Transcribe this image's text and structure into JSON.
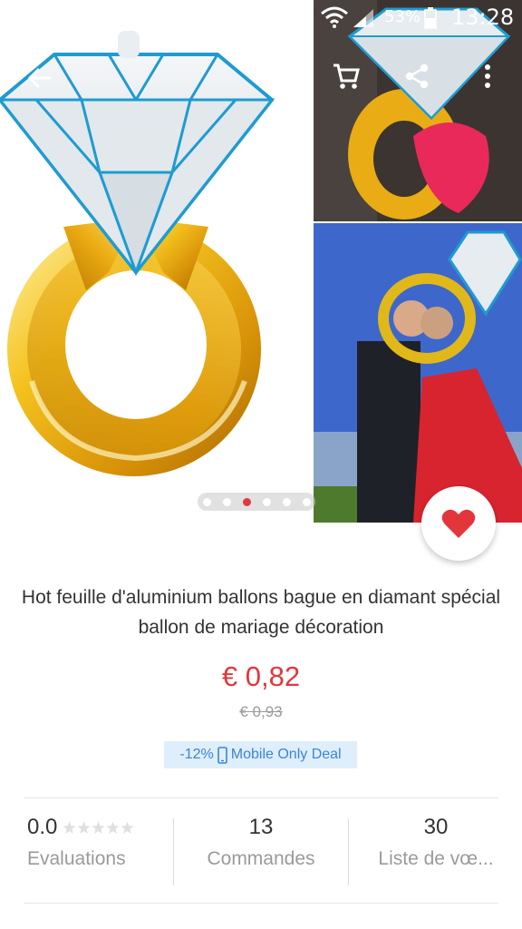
{
  "status_bar": {
    "battery_percent": "53%",
    "time": "13:28",
    "icons": [
      "gallery-icon",
      "alarm-icon",
      "wifi-icon",
      "signal-icon",
      "battery-icon"
    ]
  },
  "app_bar": {
    "icons": [
      "back-arrow-icon",
      "search-icon",
      "cart-icon",
      "share-icon",
      "more-vert-icon"
    ]
  },
  "gallery": {
    "page_count": 6,
    "active_page": 3
  },
  "product": {
    "title": "Hot feuille d'aluminium ballons bague en diamant spécial ballon de mariage décoration",
    "price": "€ 0,82",
    "original_price": "€ 0,93",
    "deal": {
      "discount": "-12%",
      "label": "Mobile Only Deal"
    }
  },
  "stats": {
    "rating": "0.0",
    "rating_stars": 0,
    "rating_label": "Evaluations",
    "orders": "13",
    "orders_label": "Commandes",
    "wishlist": "30",
    "wishlist_label": "Liste de vœ..."
  },
  "colors": {
    "accent": "#e2363a",
    "deal_bg": "#dfeefb",
    "deal_text": "#3a86d6"
  }
}
